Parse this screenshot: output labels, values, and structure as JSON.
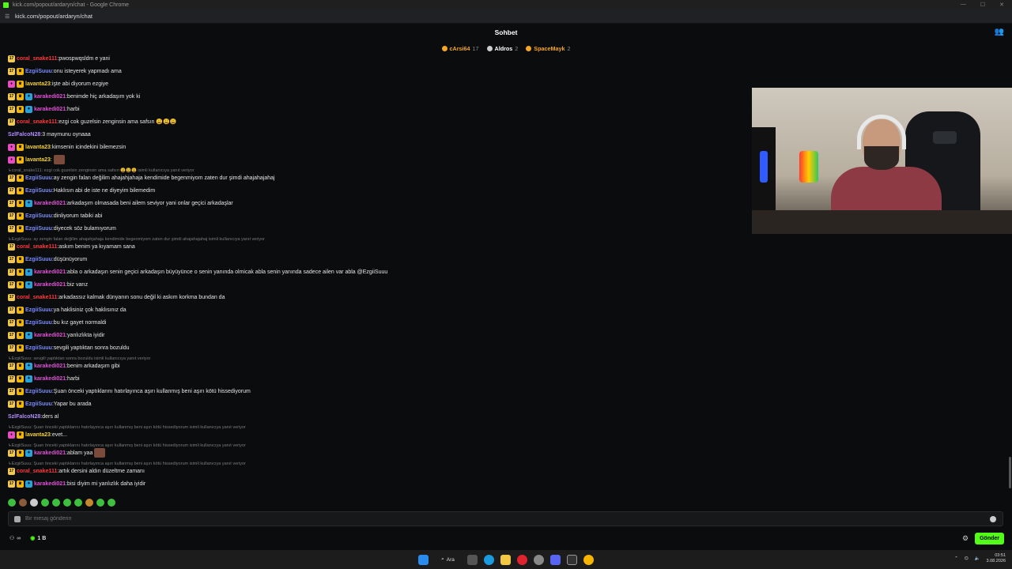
{
  "browser": {
    "window_title": "kick.com/popout/ardaryn/chat - Google Chrome",
    "url": "kick.com/popout/ardaryn/chat"
  },
  "header": {
    "title": "Sohbet"
  },
  "top_gifters": [
    {
      "name": "cArsi64",
      "count": "17",
      "color": "#f5a623"
    },
    {
      "name": "Aldros",
      "count": "2",
      "color": "#ffffff"
    },
    {
      "name": "SpaceMayk",
      "count": "2",
      "color": "#f5a623"
    }
  ],
  "messages": [
    {
      "user": "coral_snake111",
      "color": "#ff3b3b",
      "badges": [
        "sub"
      ],
      "text": "pwospwqsldm e yani"
    },
    {
      "user": "EzgiiSuuu",
      "color": "#7b8cff",
      "badges": [
        "sub",
        "crown"
      ],
      "text": "onu isteyerek yapmadı ama"
    },
    {
      "user": "lavanta23",
      "color": "#f5d142",
      "badges": [
        "vip",
        "crown"
      ],
      "text": "işte abi diyorum ezgiye"
    },
    {
      "user": "karakedi021",
      "color": "#e24fd8",
      "badges": [
        "sub",
        "crown",
        "star"
      ],
      "text": "benimde hiç arkadaşım yok ki"
    },
    {
      "user": "karakedi021",
      "color": "#e24fd8",
      "badges": [
        "sub",
        "crown",
        "star"
      ],
      "text": "harbi"
    },
    {
      "user": "coral_snake111",
      "color": "#ff3b3b",
      "badges": [
        "sub"
      ],
      "text": "ezgi cok guzelsin zenginsin ama safsın 😩😩😩"
    },
    {
      "user": "SzlFalcoN28",
      "color": "#b18cff",
      "badges": [],
      "text": "3 maymunu oynaaa"
    },
    {
      "user": "lavanta23",
      "color": "#f5d142",
      "badges": [
        "vip",
        "crown"
      ],
      "text": "kimsenin icindekini bilemezsin"
    },
    {
      "user": "lavanta23",
      "color": "#f5d142",
      "badges": [
        "vip",
        "crown"
      ],
      "text": "",
      "emote": true
    },
    {
      "reply": "coral_snake111: ezgi cok guzelsin zenginsin ama safsın 😩😩😩 isimli kullanıcıya yanıt veriyor"
    },
    {
      "user": "EzgiiSuuu",
      "color": "#7b8cff",
      "badges": [
        "sub",
        "crown"
      ],
      "text": "ay zengin falan değilim ahajahjahaja kendimide begenmiyom zaten dur şimdi ahajahajahaj"
    },
    {
      "user": "EzgiiSuuu",
      "color": "#7b8cff",
      "badges": [
        "sub",
        "crown"
      ],
      "text": "Haklısın abi de iste ne diyeyim bilemedim"
    },
    {
      "user": "karakedi021",
      "color": "#e24fd8",
      "badges": [
        "sub",
        "crown",
        "star"
      ],
      "text": "arkadaşım olmasada beni ailem seviyor yani onlar geçici arkadaşlar"
    },
    {
      "user": "EzgiiSuuu",
      "color": "#7b8cff",
      "badges": [
        "sub",
        "crown"
      ],
      "text": "dinliyorum tabiki abi"
    },
    {
      "user": "EzgiiSuuu",
      "color": "#7b8cff",
      "badges": [
        "sub",
        "crown"
      ],
      "text": "diyecek söz bulamıyorum"
    },
    {
      "reply": "EzgiiSuuu: ay zengin falan değilim ahajahjahaja kendimide begenmiyom zaten dur şimdi ahajahajahaj isimli kullanıcıya yanıt veriyor"
    },
    {
      "user": "coral_snake111",
      "color": "#ff3b3b",
      "badges": [
        "sub"
      ],
      "text": "askım benim ya kıyamam sana"
    },
    {
      "user": "EzgiiSuuu",
      "color": "#7b8cff",
      "badges": [
        "sub",
        "crown"
      ],
      "text": "düşünüyorum"
    },
    {
      "user": "karakedi021",
      "color": "#e24fd8",
      "badges": [
        "sub",
        "crown",
        "star"
      ],
      "text": "abla o arkadaşın senin geçici arkadaşın büyüyünce o senin yanında olmicak abla senin yanında sadece ailen var abla @EzgiiSuuu"
    },
    {
      "user": "karakedi021",
      "color": "#e24fd8",
      "badges": [
        "sub",
        "crown",
        "star"
      ],
      "text": "biz varız"
    },
    {
      "user": "coral_snake111",
      "color": "#ff3b3b",
      "badges": [
        "sub"
      ],
      "text": "arkadassız kalmak dünyanın sonu değil ki askım korkma bundan da"
    },
    {
      "user": "EzgiiSuuu",
      "color": "#7b8cff",
      "badges": [
        "sub",
        "crown"
      ],
      "text": "ya haklisiniz çok haklısınız da"
    },
    {
      "user": "EzgiiSuuu",
      "color": "#7b8cff",
      "badges": [
        "sub",
        "crown"
      ],
      "text": "bu kız gayet normaldi"
    },
    {
      "user": "karakedi021",
      "color": "#e24fd8",
      "badges": [
        "sub",
        "crown",
        "star"
      ],
      "text": "yanlızlıkta iyidir"
    },
    {
      "user": "EzgiiSuuu",
      "color": "#7b8cff",
      "badges": [
        "sub",
        "crown"
      ],
      "text": "sevgili yaptıktan sonra bozuldu"
    },
    {
      "reply": "EzgiiSuuu: sevgili yaptıktan sonra bozuldu isimli kullanıcıya yanıt veriyor"
    },
    {
      "user": "karakedi021",
      "color": "#e24fd8",
      "badges": [
        "sub",
        "crown",
        "star"
      ],
      "text": "benim arkadaşım gibi"
    },
    {
      "user": "karakedi021",
      "color": "#e24fd8",
      "badges": [
        "sub",
        "crown",
        "star"
      ],
      "text": "harbi"
    },
    {
      "user": "EzgiiSuuu",
      "color": "#7b8cff",
      "badges": [
        "sub",
        "crown"
      ],
      "text": "Şuan önceki yaptıklarını hatırlayınca aşırı kullanmış beni aşırı kötü hissediyorum"
    },
    {
      "user": "EzgiiSuuu",
      "color": "#7b8cff",
      "badges": [
        "sub",
        "crown"
      ],
      "text": "Yapar bu arada"
    },
    {
      "user": "SzlFalcoN28",
      "color": "#b18cff",
      "badges": [],
      "text": "ders al"
    },
    {
      "reply": "EzgiiSuuu: Şuan önceki yaptıklarını hatırlayınca aşırı kullanmış beni aşırı kötü hissediyorum isimli kullanıcıya yanıt veriyor"
    },
    {
      "user": "lavanta23",
      "color": "#f5d142",
      "badges": [
        "vip",
        "crown"
      ],
      "text": "evet..."
    },
    {
      "reply": "EzgiiSuuu: Şuan önceki yaptıklarını hatırlayınca aşırı kullanmış beni aşırı kötü hissediyorum isimli kullanıcıya yanıt veriyor"
    },
    {
      "user": "karakedi021",
      "color": "#e24fd8",
      "badges": [
        "sub",
        "crown",
        "star"
      ],
      "text": "ablam yaa",
      "emote": true
    },
    {
      "reply": "EzgiiSuuu: Şuan önceki yaptıklarını hatırlayınca aşırı kullanmış beni aşırı kötü hissediyorum isimli kullanıcıya yanıt veriyor"
    },
    {
      "user": "coral_snake111",
      "color": "#ff3b3b",
      "badges": [
        "sub"
      ],
      "text": "artık dersini aldın düzeltme zamanı"
    },
    {
      "user": "karakedi021",
      "color": "#e24fd8",
      "badges": [
        "sub",
        "crown",
        "star"
      ],
      "text": "bisi diyim mi yanlızlık daha iyidir"
    }
  ],
  "emote_colors": [
    "#3fbf3f",
    "#8a5a3a",
    "#cccccc",
    "#3fbf3f",
    "#3fbf3f",
    "#3fbf3f",
    "#3fbf3f",
    "#c2892f",
    "#3fbf3f",
    "#3fbf3f"
  ],
  "input": {
    "placeholder": "Bir mesaj gönderin"
  },
  "footer": {
    "points": "∞",
    "kicks": "1 B",
    "send_label": "Gönder"
  },
  "taskbar": {
    "search_label": "Ara",
    "time": "03:51",
    "date": "3.08.2026"
  }
}
